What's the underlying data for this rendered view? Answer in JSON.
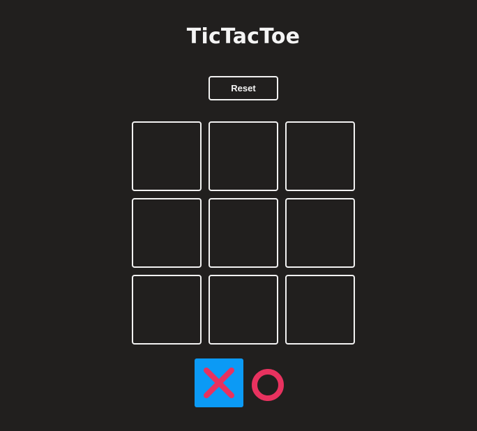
{
  "game": {
    "title": "TicTacToe",
    "reset_label": "Reset",
    "board": [
      [
        "",
        "",
        ""
      ],
      [
        "",
        "",
        ""
      ],
      [
        "",
        "",
        ""
      ]
    ]
  },
  "turn_indicator": {
    "active_player": "X",
    "players": [
      {
        "symbol": "X",
        "icon": "x-mark-icon",
        "active": true
      },
      {
        "symbol": "O",
        "icon": "o-mark-icon",
        "active": false
      }
    ]
  },
  "colors": {
    "background": "#211f1e",
    "foreground": "#f2f2f2",
    "active_highlight": "#0b9af5",
    "mark": "#e8325f"
  }
}
